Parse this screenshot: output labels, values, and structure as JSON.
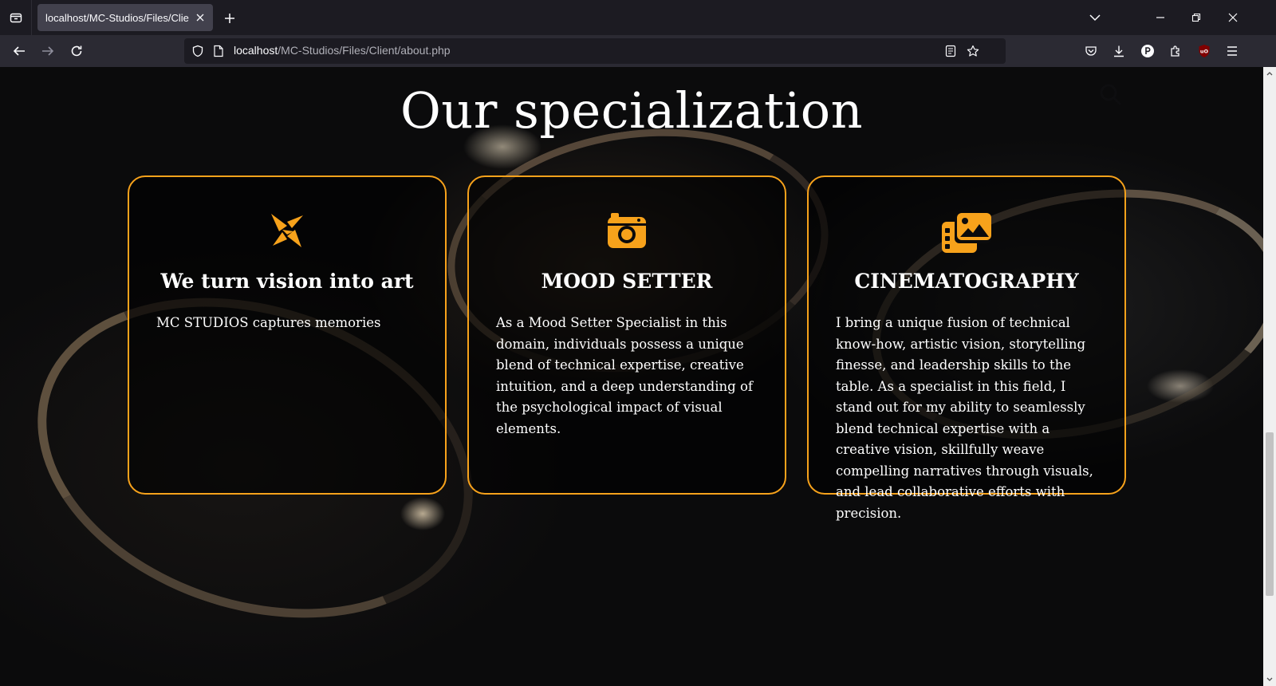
{
  "browser": {
    "tab": {
      "title": "localhost/MC-Studios/Files/Client/"
    },
    "url": {
      "host": "localhost",
      "path": "/MC-Studios/Files/Client/about.php"
    },
    "icons": [
      "tab-list-icon",
      "close-icon",
      "new-tab-icon",
      "list-all-tabs-icon",
      "minimize-icon",
      "restore-icon",
      "close-window-icon",
      "back-icon",
      "forward-icon",
      "reload-icon",
      "shield-icon",
      "page-icon",
      "reader-view-icon",
      "bookmark-star-icon",
      "pocket-icon",
      "download-icon",
      "profile-icon",
      "extensions-icon",
      "ublock-icon",
      "menu-icon"
    ]
  },
  "page": {
    "title": "Our specialization",
    "accent_color": "#f7a21b",
    "cards": [
      {
        "icon": "pinwheel-icon",
        "title": "We turn vision into art",
        "text": "MC STUDIOS captures memories"
      },
      {
        "icon": "camera-icon",
        "title": "MOOD SETTER",
        "text": "As a Mood Setter Specialist in this domain, individuals possess a unique blend of technical expertise, creative intuition, and a deep understanding of the psychological impact of visual elements."
      },
      {
        "icon": "photo-film-icon",
        "title": "CINEMATOGRAPHY",
        "text": "I bring a unique fusion of technical know-how, artistic vision, storytelling finesse, and leadership skills to the table. As a specialist in this field, I stand out for my ability to seamlessly blend technical expertise with a creative vision, skillfully weave compelling narratives through visuals, and lead collaborative efforts with precision."
      }
    ]
  }
}
